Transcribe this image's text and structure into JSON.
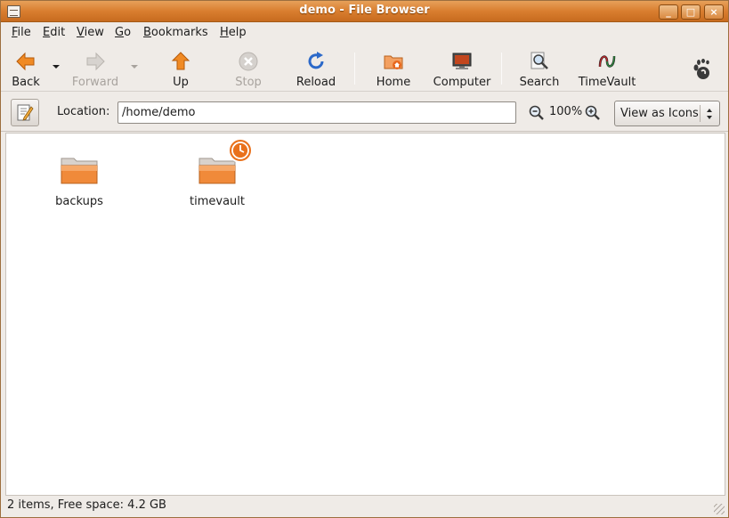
{
  "window": {
    "title": "demo - File Browser",
    "controls": {
      "minimize": "_",
      "maximize": "□",
      "close": "×"
    }
  },
  "menubar": {
    "items": [
      {
        "label": "File",
        "mnemonic": "F",
        "rest": "ile"
      },
      {
        "label": "Edit",
        "mnemonic": "E",
        "rest": "dit"
      },
      {
        "label": "View",
        "mnemonic": "V",
        "rest": "iew"
      },
      {
        "label": "Go",
        "mnemonic": "G",
        "rest": "o"
      },
      {
        "label": "Bookmarks",
        "mnemonic": "B",
        "rest": "ookmarks"
      },
      {
        "label": "Help",
        "mnemonic": "H",
        "rest": "elp"
      }
    ]
  },
  "toolbar": {
    "back": {
      "label": "Back",
      "icon": "arrow-left-icon",
      "enabled": true
    },
    "forward": {
      "label": "Forward",
      "icon": "arrow-right-icon",
      "enabled": false
    },
    "up": {
      "label": "Up",
      "icon": "arrow-up-icon",
      "enabled": true
    },
    "stop": {
      "label": "Stop",
      "icon": "stop-icon",
      "enabled": false
    },
    "reload": {
      "label": "Reload",
      "icon": "reload-icon",
      "enabled": true
    },
    "home": {
      "label": "Home",
      "icon": "home-folder-icon",
      "enabled": true
    },
    "computer": {
      "label": "Computer",
      "icon": "computer-icon",
      "enabled": true
    },
    "search": {
      "label": "Search",
      "icon": "search-icon",
      "enabled": true
    },
    "timevault": {
      "label": "TimeVault",
      "icon": "timevault-icon",
      "enabled": true
    },
    "throbber": {
      "icon": "gnome-foot-icon"
    }
  },
  "location": {
    "label": "Location:",
    "value": "/home/demo",
    "zoom_level": "100%",
    "view_mode": "View as Icons"
  },
  "files": [
    {
      "name": "backups",
      "icon": "folder-icon",
      "emblem": null
    },
    {
      "name": "timevault",
      "icon": "folder-icon",
      "emblem": "clock-emblem-icon"
    }
  ],
  "status": {
    "text": "2 items, Free space: 4.2 GB"
  },
  "colors": {
    "titlebar": "#d97e2f",
    "folder": "#f0883a",
    "accent": "#e07020"
  }
}
